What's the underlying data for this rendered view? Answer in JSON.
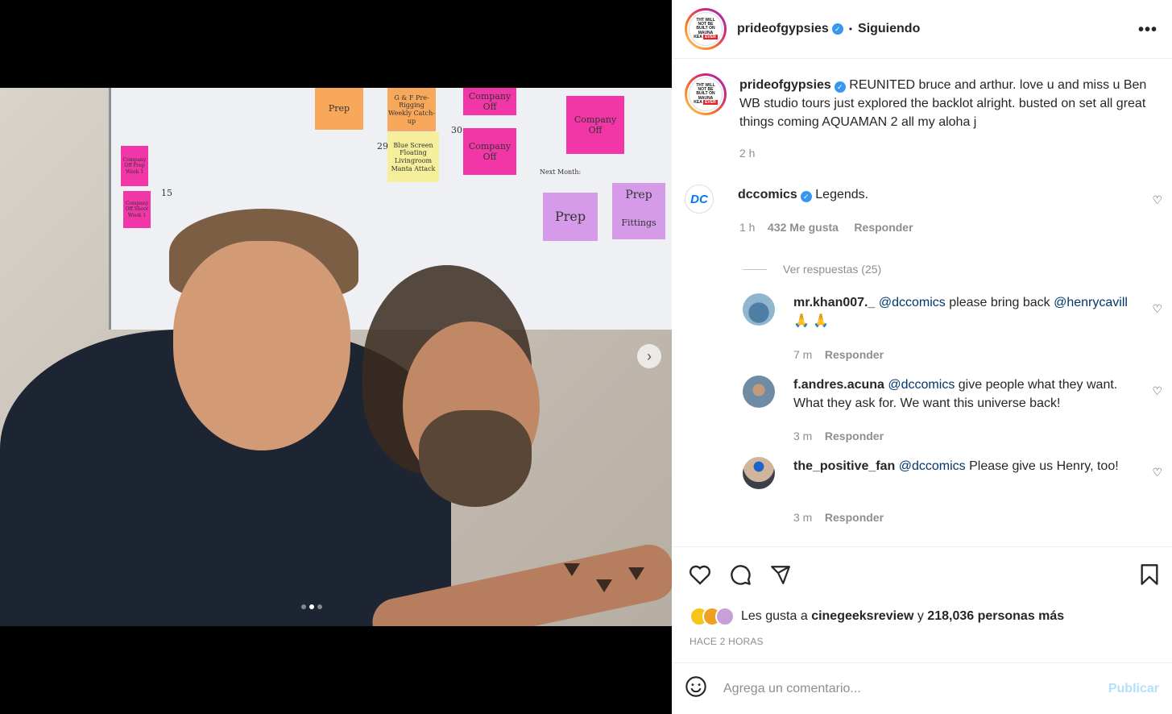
{
  "post": {
    "author": "prideofgypsies",
    "follow_status": "Siguiendo",
    "avatar_text": [
      "THT WILL",
      "NOT BE",
      "BUILT ON",
      "MAUNA",
      "KEA"
    ],
    "avatar_badge": "EVER",
    "caption_user": "prideofgypsies",
    "caption": "REUNITED bruce and arthur. love u and miss u Ben WB studio tours just explored the backlot alright. busted on set all great things coming AQUAMAN 2 all my aloha j",
    "caption_time": "2 h"
  },
  "photo": {
    "notes": [
      {
        "text": "Prep",
        "color": "orange"
      },
      {
        "text": "G & F Pre-Rigging Weekly Catch-up",
        "color": "orange"
      },
      {
        "text": "Company Off",
        "color": "pink"
      },
      {
        "text": "Blue Screen Floating Livingroom Manta Attack",
        "color": "yellow"
      },
      {
        "text": "Company Off",
        "color": "pink"
      },
      {
        "text": "Company Off",
        "color": "pink"
      },
      {
        "text": "Company Off Prep Week 1",
        "color": "pink"
      },
      {
        "text": "Company Off Shoot Week 1",
        "color": "pink"
      },
      {
        "text": "Prep",
        "color": "violet"
      },
      {
        "text": "Prep",
        "color": "violet"
      },
      {
        "text": "Fittings",
        "color": "violet"
      }
    ],
    "board_labels": {
      "next_month": "Next Month:",
      "day_29": "29",
      "day_30": "30",
      "day_15": "15"
    },
    "carousel_index": 1,
    "carousel_total": 3
  },
  "comments": [
    {
      "user": "dccomics",
      "verified": true,
      "text": "Legends.",
      "time": "1 h",
      "likes": "432 Me gusta",
      "reply_label": "Responder",
      "view_replies": "Ver respuestas (25)"
    },
    {
      "user": "mr.khan007._",
      "mention": "@dccomics",
      "text": "please bring back",
      "mention2": "@henrycavill",
      "emoji": "🙏 🙏",
      "time": "7 m",
      "reply_label": "Responder"
    },
    {
      "user": "f.andres.acuna",
      "mention": "@dccomics",
      "text": "give people what they want. What they ask for. We want this universe back!",
      "time": "3 m",
      "reply_label": "Responder"
    },
    {
      "user": "the_positive_fan",
      "mention": "@dccomics",
      "text": "Please give us Henry, too!",
      "time": "3 m",
      "reply_label": "Responder"
    }
  ],
  "actions": {
    "likes_prefix": "Les gusta a",
    "likes_user": "cinegeeksreview",
    "likes_and": "y",
    "likes_count": "218,036 personas más",
    "time_ago": "HACE 2 HORAS",
    "comment_placeholder": "Agrega un comentario...",
    "publish_label": "Publicar"
  },
  "colors": {
    "link": "#00376b",
    "verified": "#3897f0",
    "muted": "#8e8e8e",
    "publish_disabled": "#b2dffc"
  },
  "icons": [
    "more-icon",
    "heart-icon",
    "comment-icon",
    "share-icon",
    "save-icon",
    "emoji-icon",
    "verified-icon",
    "chevron-right-icon"
  ]
}
